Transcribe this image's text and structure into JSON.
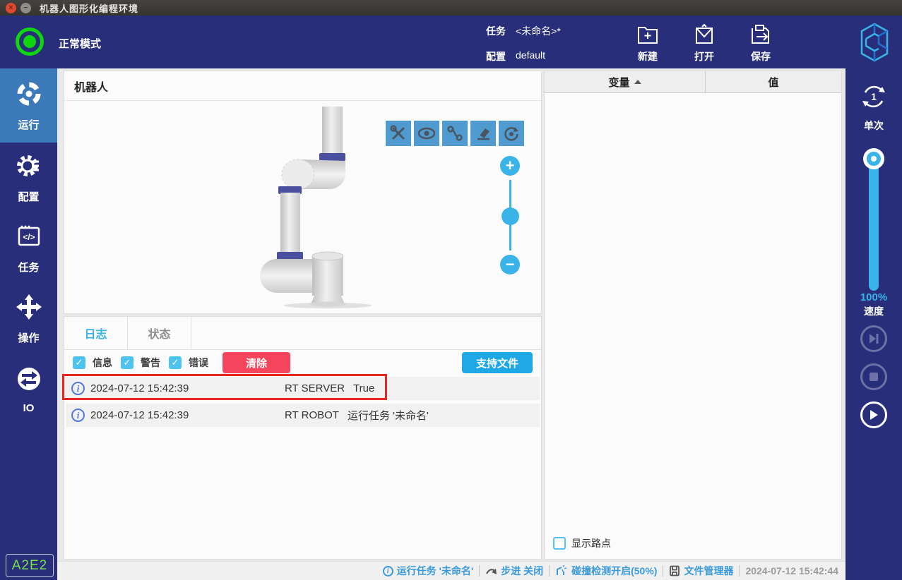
{
  "window": {
    "title": "机器人图形化编程环境",
    "mode_label": "正常模式",
    "task_label": "任务",
    "task_value": "<未命名>*",
    "config_label": "配置",
    "config_value": "default",
    "actions": {
      "new": "新建",
      "open": "打开",
      "save": "保存"
    }
  },
  "sidebar": {
    "items": [
      {
        "label": "运行",
        "icon": "run-icon",
        "active": true
      },
      {
        "label": "配置",
        "icon": "settings-icon",
        "active": false
      },
      {
        "label": "任务",
        "icon": "task-icon",
        "active": false
      },
      {
        "label": "操作",
        "icon": "operate-icon",
        "active": false
      },
      {
        "label": "IO",
        "icon": "io-icon",
        "active": false
      }
    ],
    "badge": "A2E2"
  },
  "robot_panel": {
    "title": "机器人",
    "toolbar_icons": [
      "tools-icon",
      "eye-icon",
      "path-icon",
      "eraser-icon",
      "reset-view-icon"
    ]
  },
  "log_panel": {
    "tabs": [
      {
        "label": "日志",
        "active": true
      },
      {
        "label": "状态",
        "active": false
      }
    ],
    "filters": [
      {
        "label": "信息",
        "checked": true
      },
      {
        "label": "警告",
        "checked": true
      },
      {
        "label": "错误",
        "checked": true
      }
    ],
    "clear_button": "清除",
    "support_button": "支持文件",
    "entries": [
      {
        "time": "2024-07-12 15:42:39",
        "source": "RT SERVER",
        "message": "True",
        "highlighted": true
      },
      {
        "time": "2024-07-12 15:42:39",
        "source": "RT ROBOT",
        "message": "运行任务 '未命名'",
        "highlighted": false
      }
    ]
  },
  "variable_panel": {
    "columns": {
      "name": "变量",
      "value": "值"
    },
    "rows": [],
    "show_waypoints_label": "显示路点",
    "show_waypoints_checked": false
  },
  "right_toolbar": {
    "cycle_label": "单次",
    "cycle_count": "1",
    "speed_percent": "100%",
    "speed_label": "速度"
  },
  "status_bar": {
    "running_task": "运行任务 '未命名'",
    "step_mode": "步进 关闭",
    "collision": "碰撞检测开启(50%)",
    "file_manager": "文件管理器",
    "time": "2024-07-12 15:42:44"
  },
  "colors": {
    "navy": "#282e7a",
    "accent_cyan": "#3ab4e8",
    "active_nav_blue": "#3c79b8",
    "toolbar_blue": "#4f9bd0",
    "clear_red": "#f5455c",
    "support_blue": "#1ea9e6",
    "mode_green": "#0fd60f",
    "link_blue": "#3a9ad9",
    "annotation_red": "#e8251f"
  }
}
